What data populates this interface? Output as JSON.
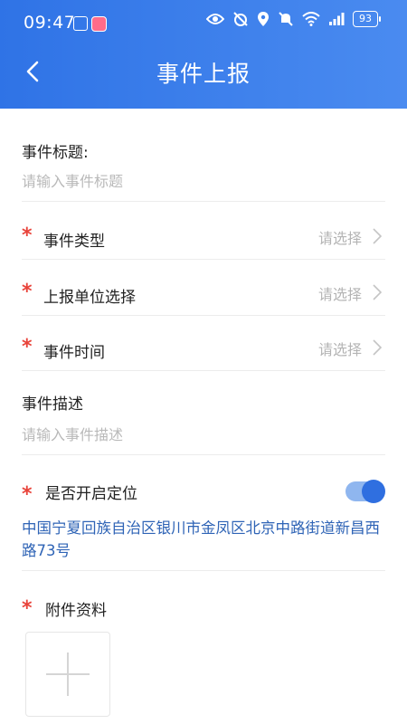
{
  "status_bar": {
    "time": "09:47",
    "battery": "93"
  },
  "header": {
    "title": "事件上报"
  },
  "form": {
    "event_title": {
      "label": "事件标题:",
      "placeholder": "请输入事件标题"
    },
    "event_type": {
      "label": "事件类型",
      "value": "请选择",
      "required": true
    },
    "report_unit": {
      "label": "上报单位选择",
      "value": "请选择",
      "required": true
    },
    "event_time": {
      "label": "事件时间",
      "value": "请选择",
      "required": true
    },
    "event_description": {
      "label": "事件描述",
      "placeholder": "请输入事件描述"
    },
    "location": {
      "label": "是否开启定位",
      "enabled": true,
      "required": true,
      "address": "中国宁夏回族自治区银川市金凤区北京中路街道新昌西路73号"
    },
    "attachments": {
      "label": "附件资料",
      "required": true
    }
  },
  "colors": {
    "header_blue": "#3b7fec",
    "required_star": "#e8433a",
    "address_text": "#2f64b6",
    "placeholder_gray": "#b4b4b4",
    "toggle_on": "#2f6fe0"
  },
  "icons": {
    "back": "chevron-left-icon",
    "select_arrow": "chevron-right-icon",
    "upload": "plus-icon"
  },
  "required_mark": "*"
}
